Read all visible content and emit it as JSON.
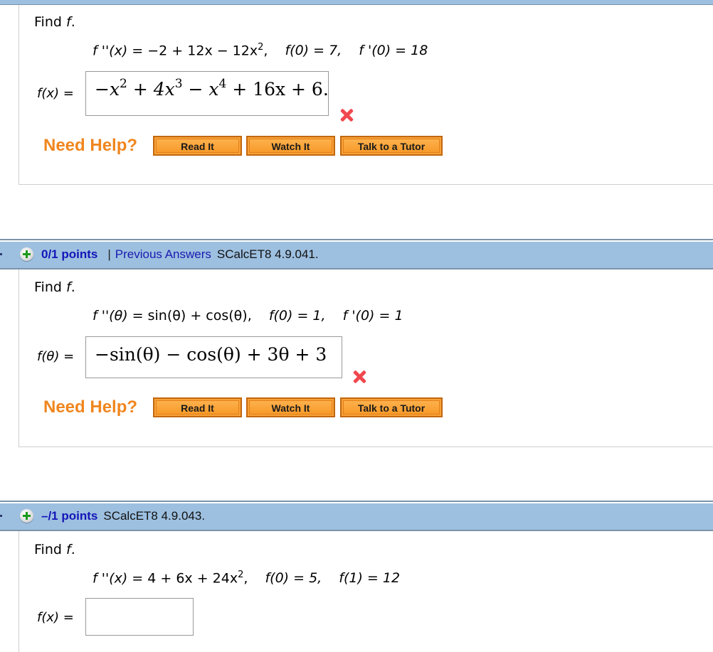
{
  "questions": [
    {
      "instruction": "Find",
      "instruction_var": "f",
      "equation": {
        "fpp": "f ''(x)",
        "fpp_rhs": "= −2 + 12x − 12x",
        "fpp_exp": "2",
        "cond1": "f(0) = 7,",
        "cond2": "f '(0) = 18"
      },
      "answer_label": "f(x) =",
      "answer": {
        "parts": [
          "−x",
          "2",
          " + 4x",
          "3",
          " − x",
          "4",
          " + 16x + 6."
        ]
      },
      "status": "incorrect",
      "help": {
        "label": "Need Help?",
        "buttons": [
          "Read It",
          "Watch It",
          "Talk to a Tutor"
        ]
      }
    },
    {
      "points": "0/1 points",
      "separator": "|",
      "previous_answers": "Previous Answers",
      "code": "SCalcET8 4.9.041.",
      "instruction": "Find",
      "instruction_var": "f",
      "equation": {
        "fpp": "f ''(θ)",
        "fpp_rhs": "= sin(θ) + cos(θ),",
        "cond1": "f(0) = 1,",
        "cond2": "f '(0) = 1"
      },
      "answer_label": "f(θ) =",
      "answer": {
        "text": "−sin(θ) − cos(θ) + 3θ + 3"
      },
      "status": "incorrect",
      "help": {
        "label": "Need Help?",
        "buttons": [
          "Read It",
          "Watch It",
          "Talk to a Tutor"
        ]
      }
    },
    {
      "points": "–/1 points",
      "code": "SCalcET8 4.9.043.",
      "instruction": "Find",
      "instruction_var": "f",
      "equation": {
        "fpp": "f ''(x)",
        "fpp_rhs": "= 4 + 6x + 24x",
        "fpp_exp": "2",
        "cond1": "f(0) = 5,",
        "cond2": "f(1) = 12"
      },
      "answer_label": "f(x) =",
      "answer": {
        "value": ""
      }
    }
  ],
  "colors": {
    "header_bg": "#9dc0e0",
    "points": "#1515b8",
    "need_help": "#f0861e",
    "wrong": "#f0474f"
  }
}
